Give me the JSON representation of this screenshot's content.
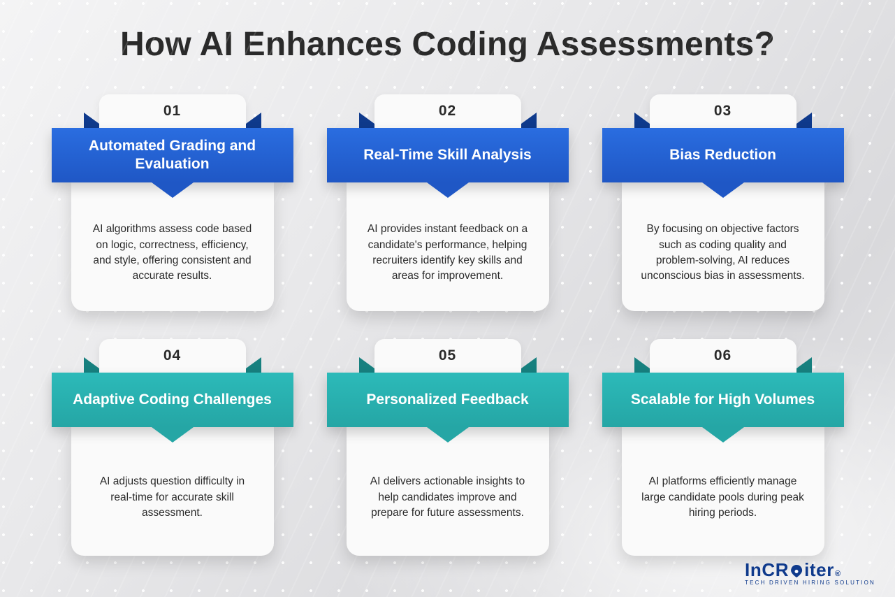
{
  "title": "How AI Enhances Coding Assessments?",
  "colors": {
    "variantA": "#1f57c5",
    "variantB": "#25a6a5"
  },
  "cards": [
    {
      "num": "01",
      "variant": "A",
      "heading": "Automated Grading and Evaluation",
      "desc": "AI algorithms assess code based on logic, correctness, efficiency, and style, offering consistent and accurate results."
    },
    {
      "num": "02",
      "variant": "A",
      "heading": "Real-Time Skill Analysis",
      "desc": "AI provides instant feedback on a candidate's performance, helping recruiters identify key skills and areas for improvement."
    },
    {
      "num": "03",
      "variant": "A",
      "heading": "Bias Reduction",
      "desc": "By focusing on objective factors such as coding quality and problem-solving, AI reduces unconscious bias in assessments."
    },
    {
      "num": "04",
      "variant": "B",
      "heading": "Adaptive Coding Challenges",
      "desc": "AI adjusts question difficulty in real-time for accurate skill assessment."
    },
    {
      "num": "05",
      "variant": "B",
      "heading": "Personalized Feedback",
      "desc": "AI delivers actionable insights to help candidates improve and prepare for future assessments."
    },
    {
      "num": "06",
      "variant": "B",
      "heading": "Scalable for High Volumes",
      "desc": "AI platforms efficiently manage large candidate pools during peak hiring periods."
    }
  ],
  "brand": {
    "name_parts": [
      "InCR",
      "iter"
    ],
    "tagline": "TECH DRIVEN HIRING SOLUTION",
    "registered": "®"
  }
}
